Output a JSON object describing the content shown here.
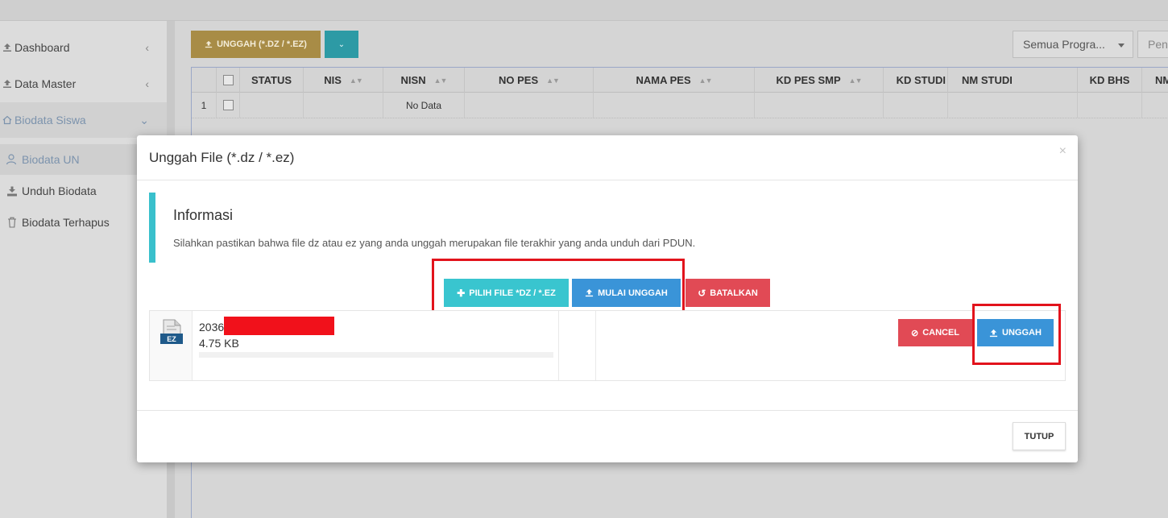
{
  "sidebar": {
    "items": [
      {
        "label": "Dashboard",
        "icon": "upload-icon",
        "expanded": false
      },
      {
        "label": "Data Master",
        "icon": "upload-icon",
        "expanded": false
      },
      {
        "label": "Biodata Siswa",
        "icon": "home-icon",
        "expanded": true
      }
    ],
    "sub_items": [
      {
        "label": "Biodata UN",
        "icon": "users-icon",
        "active": true
      },
      {
        "label": "Unduh Biodata",
        "icon": "download-icon",
        "active": false
      },
      {
        "label": "Biodata Terhapus",
        "icon": "trash-icon",
        "active": false
      }
    ]
  },
  "toolbar": {
    "upload_label": "UNGGAH (*.DZ / *.EZ)",
    "program_select_value": "Semua Progra...",
    "search_placeholder": "Pen"
  },
  "grid": {
    "columns": [
      "STATUS",
      "NIS",
      "NISN",
      "NO PES",
      "NAMA PES",
      "KD PES SMP",
      "KD STUDI",
      "NM STUDI",
      "KD BHS",
      "NM"
    ],
    "row_number": "1",
    "empty_text": "No Data"
  },
  "modal": {
    "title": "Unggah File (*.dz / *.ez)",
    "close_symbol": "×",
    "info": {
      "title": "Informasi",
      "text": "Silahkan pastikan bahwa file dz atau ez yang anda unggah merupakan file terakhir yang anda unduh dari PDUN."
    },
    "buttons": {
      "choose_file": "PILIH FILE *DZ / *.EZ",
      "start_upload": "MULAI UNGGAH",
      "cancel_all": "BATALKAN"
    },
    "file": {
      "icon_label": "EZ",
      "name_prefix": "2036",
      "size": "4.75 KB",
      "progress": 0,
      "cancel_label": "CANCEL",
      "upload_label": "UNGGAH"
    },
    "close_button": "TUTUP"
  },
  "colors": {
    "upload_gold": "#a88c46",
    "teal": "#39c5cf",
    "blue": "#3a94d8",
    "red": "#e14a55",
    "highlight_red": "#e2131c",
    "info_accent": "#39c0cc"
  }
}
